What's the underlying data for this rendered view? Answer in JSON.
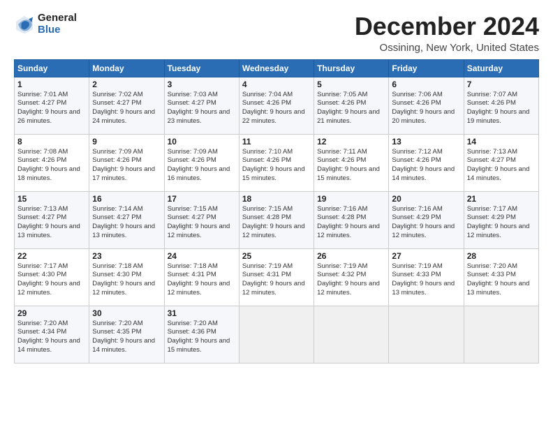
{
  "logo": {
    "general": "General",
    "blue": "Blue"
  },
  "title": "December 2024",
  "location": "Ossining, New York, United States",
  "header_days": [
    "Sunday",
    "Monday",
    "Tuesday",
    "Wednesday",
    "Thursday",
    "Friday",
    "Saturday"
  ],
  "weeks": [
    [
      {
        "day": "1",
        "sunrise": "Sunrise: 7:01 AM",
        "sunset": "Sunset: 4:27 PM",
        "daylight": "Daylight: 9 hours and 26 minutes."
      },
      {
        "day": "2",
        "sunrise": "Sunrise: 7:02 AM",
        "sunset": "Sunset: 4:27 PM",
        "daylight": "Daylight: 9 hours and 24 minutes."
      },
      {
        "day": "3",
        "sunrise": "Sunrise: 7:03 AM",
        "sunset": "Sunset: 4:27 PM",
        "daylight": "Daylight: 9 hours and 23 minutes."
      },
      {
        "day": "4",
        "sunrise": "Sunrise: 7:04 AM",
        "sunset": "Sunset: 4:26 PM",
        "daylight": "Daylight: 9 hours and 22 minutes."
      },
      {
        "day": "5",
        "sunrise": "Sunrise: 7:05 AM",
        "sunset": "Sunset: 4:26 PM",
        "daylight": "Daylight: 9 hours and 21 minutes."
      },
      {
        "day": "6",
        "sunrise": "Sunrise: 7:06 AM",
        "sunset": "Sunset: 4:26 PM",
        "daylight": "Daylight: 9 hours and 20 minutes."
      },
      {
        "day": "7",
        "sunrise": "Sunrise: 7:07 AM",
        "sunset": "Sunset: 4:26 PM",
        "daylight": "Daylight: 9 hours and 19 minutes."
      }
    ],
    [
      {
        "day": "8",
        "sunrise": "Sunrise: 7:08 AM",
        "sunset": "Sunset: 4:26 PM",
        "daylight": "Daylight: 9 hours and 18 minutes."
      },
      {
        "day": "9",
        "sunrise": "Sunrise: 7:09 AM",
        "sunset": "Sunset: 4:26 PM",
        "daylight": "Daylight: 9 hours and 17 minutes."
      },
      {
        "day": "10",
        "sunrise": "Sunrise: 7:09 AM",
        "sunset": "Sunset: 4:26 PM",
        "daylight": "Daylight: 9 hours and 16 minutes."
      },
      {
        "day": "11",
        "sunrise": "Sunrise: 7:10 AM",
        "sunset": "Sunset: 4:26 PM",
        "daylight": "Daylight: 9 hours and 15 minutes."
      },
      {
        "day": "12",
        "sunrise": "Sunrise: 7:11 AM",
        "sunset": "Sunset: 4:26 PM",
        "daylight": "Daylight: 9 hours and 15 minutes."
      },
      {
        "day": "13",
        "sunrise": "Sunrise: 7:12 AM",
        "sunset": "Sunset: 4:26 PM",
        "daylight": "Daylight: 9 hours and 14 minutes."
      },
      {
        "day": "14",
        "sunrise": "Sunrise: 7:13 AM",
        "sunset": "Sunset: 4:27 PM",
        "daylight": "Daylight: 9 hours and 14 minutes."
      }
    ],
    [
      {
        "day": "15",
        "sunrise": "Sunrise: 7:13 AM",
        "sunset": "Sunset: 4:27 PM",
        "daylight": "Daylight: 9 hours and 13 minutes."
      },
      {
        "day": "16",
        "sunrise": "Sunrise: 7:14 AM",
        "sunset": "Sunset: 4:27 PM",
        "daylight": "Daylight: 9 hours and 13 minutes."
      },
      {
        "day": "17",
        "sunrise": "Sunrise: 7:15 AM",
        "sunset": "Sunset: 4:27 PM",
        "daylight": "Daylight: 9 hours and 12 minutes."
      },
      {
        "day": "18",
        "sunrise": "Sunrise: 7:15 AM",
        "sunset": "Sunset: 4:28 PM",
        "daylight": "Daylight: 9 hours and 12 minutes."
      },
      {
        "day": "19",
        "sunrise": "Sunrise: 7:16 AM",
        "sunset": "Sunset: 4:28 PM",
        "daylight": "Daylight: 9 hours and 12 minutes."
      },
      {
        "day": "20",
        "sunrise": "Sunrise: 7:16 AM",
        "sunset": "Sunset: 4:29 PM",
        "daylight": "Daylight: 9 hours and 12 minutes."
      },
      {
        "day": "21",
        "sunrise": "Sunrise: 7:17 AM",
        "sunset": "Sunset: 4:29 PM",
        "daylight": "Daylight: 9 hours and 12 minutes."
      }
    ],
    [
      {
        "day": "22",
        "sunrise": "Sunrise: 7:17 AM",
        "sunset": "Sunset: 4:30 PM",
        "daylight": "Daylight: 9 hours and 12 minutes."
      },
      {
        "day": "23",
        "sunrise": "Sunrise: 7:18 AM",
        "sunset": "Sunset: 4:30 PM",
        "daylight": "Daylight: 9 hours and 12 minutes."
      },
      {
        "day": "24",
        "sunrise": "Sunrise: 7:18 AM",
        "sunset": "Sunset: 4:31 PM",
        "daylight": "Daylight: 9 hours and 12 minutes."
      },
      {
        "day": "25",
        "sunrise": "Sunrise: 7:19 AM",
        "sunset": "Sunset: 4:31 PM",
        "daylight": "Daylight: 9 hours and 12 minutes."
      },
      {
        "day": "26",
        "sunrise": "Sunrise: 7:19 AM",
        "sunset": "Sunset: 4:32 PM",
        "daylight": "Daylight: 9 hours and 12 minutes."
      },
      {
        "day": "27",
        "sunrise": "Sunrise: 7:19 AM",
        "sunset": "Sunset: 4:33 PM",
        "daylight": "Daylight: 9 hours and 13 minutes."
      },
      {
        "day": "28",
        "sunrise": "Sunrise: 7:20 AM",
        "sunset": "Sunset: 4:33 PM",
        "daylight": "Daylight: 9 hours and 13 minutes."
      }
    ],
    [
      {
        "day": "29",
        "sunrise": "Sunrise: 7:20 AM",
        "sunset": "Sunset: 4:34 PM",
        "daylight": "Daylight: 9 hours and 14 minutes."
      },
      {
        "day": "30",
        "sunrise": "Sunrise: 7:20 AM",
        "sunset": "Sunset: 4:35 PM",
        "daylight": "Daylight: 9 hours and 14 minutes."
      },
      {
        "day": "31",
        "sunrise": "Sunrise: 7:20 AM",
        "sunset": "Sunset: 4:36 PM",
        "daylight": "Daylight: 9 hours and 15 minutes."
      },
      null,
      null,
      null,
      null
    ]
  ]
}
